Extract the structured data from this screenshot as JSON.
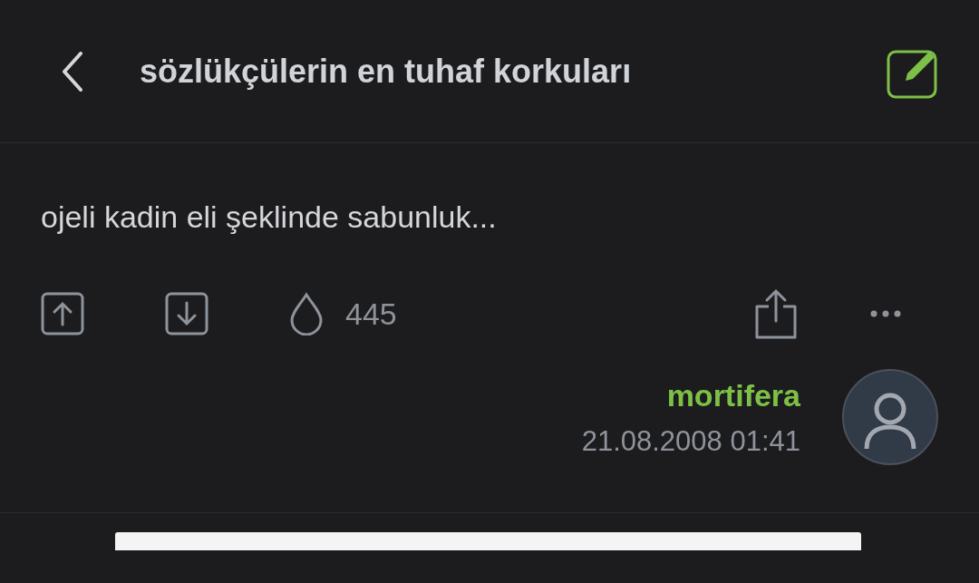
{
  "header": {
    "title": "sözlükçülerin en tuhaf korkuları"
  },
  "entry": {
    "text": "ojeli kadin eli şeklinde sabunluk...",
    "favorite_count": "445"
  },
  "author": {
    "name": "mortifera",
    "date": "21.08.2008 01:41"
  }
}
